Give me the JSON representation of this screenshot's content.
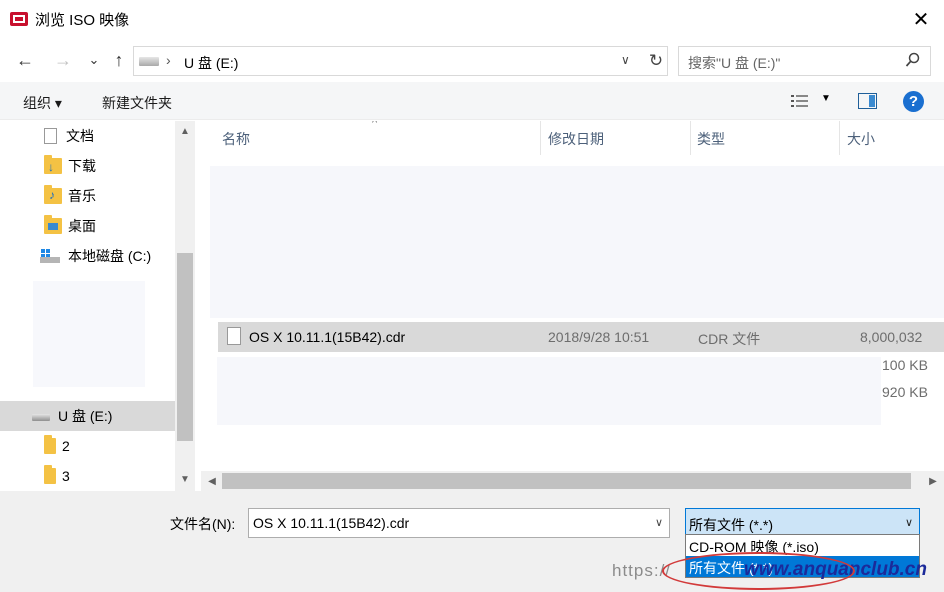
{
  "window": {
    "title": "浏览 ISO 映像",
    "close_glyph": "✕"
  },
  "nav": {
    "back_glyph": "←",
    "forward_glyph": "→",
    "recent_glyph": "⌄",
    "up_glyph": "↑",
    "address_sep": "›",
    "address_path": "U 盘 (E:)",
    "address_dropdown": "∨",
    "refresh_glyph": "↻",
    "search_placeholder": "搜索\"U 盘 (E:)\""
  },
  "toolbar": {
    "organize_label": "组织 ▾",
    "new_folder_label": "新建文件夹",
    "view_dropdown": "▼",
    "help_label": "?"
  },
  "sidebar": {
    "items": [
      {
        "label": "文档",
        "icon": "document-icon"
      },
      {
        "label": "下载",
        "icon": "download-folder-icon"
      },
      {
        "label": "音乐",
        "icon": "music-folder-icon"
      },
      {
        "label": "桌面",
        "icon": "desktop-folder-icon"
      },
      {
        "label": "本地磁盘 (C:)",
        "icon": "windows-drive-icon"
      },
      {
        "label": "U 盘 (E:)",
        "icon": "usb-drive-icon",
        "selected": true
      },
      {
        "label": "2",
        "icon": "folder-icon"
      },
      {
        "label": "3",
        "icon": "folder-icon"
      }
    ],
    "scroll_up": "▲",
    "scroll_down": "▼"
  },
  "filelist": {
    "columns": [
      "名称",
      "修改日期",
      "类型",
      "大小"
    ],
    "sort_glyph": "^",
    "rows": [
      {
        "name": "OS X 10.11.1(15B42).cdr",
        "modified": "2018/9/28 10:51",
        "type": "CDR 文件",
        "size": "8,000,032"
      }
    ],
    "extra_sizes": [
      "100 KB",
      "920 KB"
    ],
    "scroll_left": "◀",
    "scroll_right": "▶"
  },
  "bottom": {
    "filename_label": "文件名(N):",
    "filename_value": "OS X 10.11.1(15B42).cdr",
    "filename_dropdown": "∨",
    "filetype_value": "所有文件 (*.*)",
    "filetype_dropdown": "∨",
    "filetype_options": [
      "CD-ROM 映像 (*.iso)",
      "所有文件 (*.*)"
    ]
  },
  "watermark": {
    "prefix": "https://",
    "site": "www.anquanclub.cn"
  },
  "colors": {
    "selection": "#0078d7",
    "select_bg": "#cce4f7",
    "row_highlight": "#d9d9d9",
    "annotation_ellipse": "#d23a3a"
  }
}
